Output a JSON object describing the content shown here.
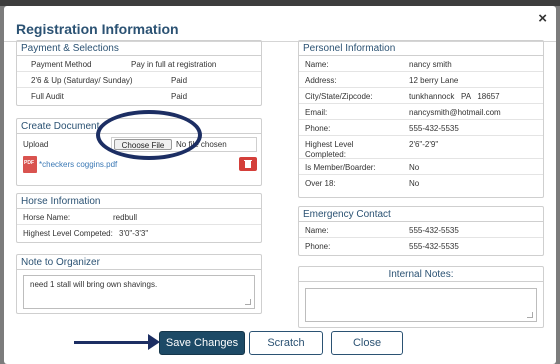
{
  "dialog": {
    "title": "Registration Information",
    "close": "×"
  },
  "payment": {
    "title": "Payment & Selections",
    "rows": [
      {
        "label": "Payment Method",
        "value": "Pay in full at registration"
      },
      {
        "label": "2'6 & Up (Saturday/ Sunday)",
        "value": "Paid"
      },
      {
        "label": "Full Audit",
        "value": "Paid"
      }
    ]
  },
  "documents": {
    "title": "Create Document",
    "upload_label": "Upload",
    "choose_file": "Choose File",
    "no_file": "No file chosen",
    "file_name": "*checkers coggins.pdf",
    "pdf_icon_text": "PDF"
  },
  "horse": {
    "title": "Horse Information",
    "rows": [
      {
        "label": "Horse Name:",
        "value": "redbull"
      },
      {
        "label": "Highest Level Competed:",
        "value": "3'0\"-3'3\""
      }
    ]
  },
  "note": {
    "title": "Note to Organizer",
    "text": "need 1 stall will bring own shavings."
  },
  "personnel": {
    "title": "Personel Information",
    "rows": [
      {
        "label": "Name:",
        "value": "nancy smith"
      },
      {
        "label": "Address:",
        "value": "12 berry Lane"
      },
      {
        "label": "City/State/Zipcode:",
        "value": "tunkhannock   PA   18657"
      },
      {
        "label": "Email:",
        "value": "nancysmith@hotmail.com"
      },
      {
        "label": "Phone:",
        "value": "555-432-5535"
      },
      {
        "label": "Highest Level Completed:",
        "value": "2'6\"-2'9\""
      },
      {
        "label": "Is Member/Boarder:",
        "value": "No"
      },
      {
        "label": "Over 18:",
        "value": "No"
      }
    ]
  },
  "emergency": {
    "title": "Emergency Contact",
    "rows": [
      {
        "label": "Name:",
        "value": "555-432-5535"
      },
      {
        "label": "Phone:",
        "value": "555-432-5535"
      }
    ]
  },
  "internal": {
    "title": "Internal Notes:"
  },
  "buttons": {
    "save": "Save Changes",
    "scratch": "Scratch",
    "close": "Close"
  },
  "colors": {
    "primary": "#1d4a66",
    "title": "#2b5273",
    "annotation": "#1c2e63",
    "delete": "#d43f3a"
  }
}
